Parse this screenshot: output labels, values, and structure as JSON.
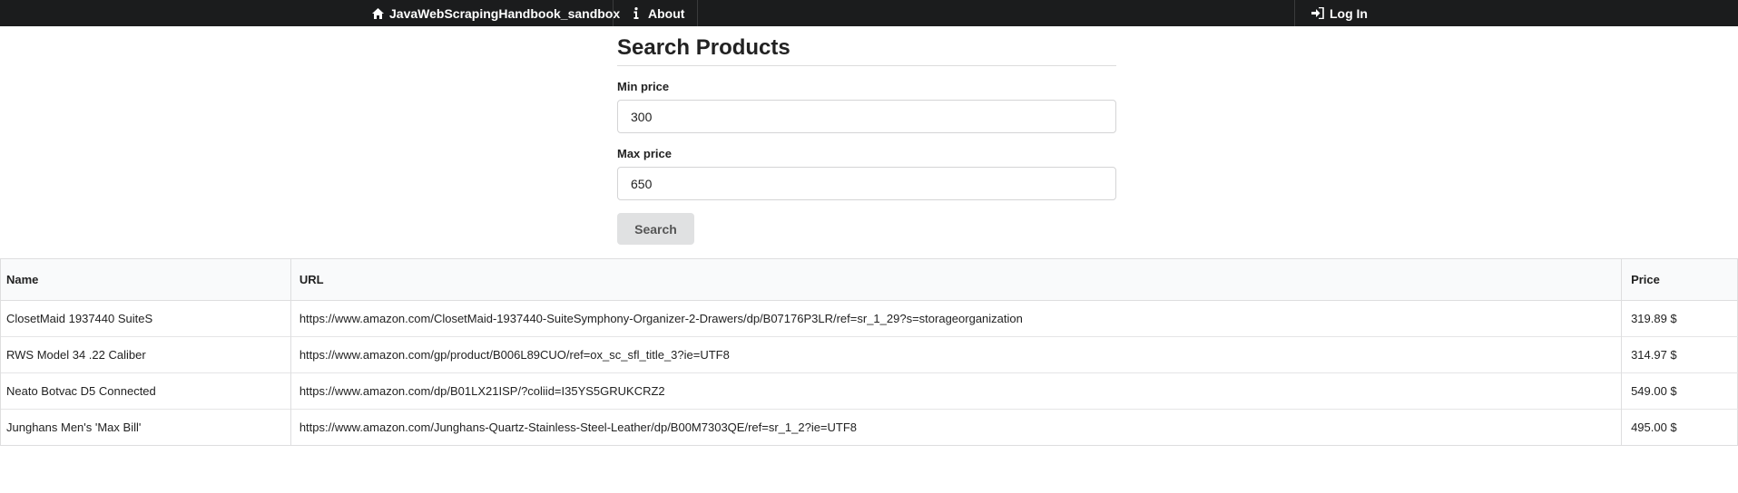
{
  "nav": {
    "brand_label": "JavaWebScrapingHandbook_sandbox",
    "brand_icon": "home-icon",
    "about_label": "About",
    "about_icon": "info-icon",
    "login_label": "Log In",
    "login_icon": "sign-in-icon"
  },
  "form": {
    "title": "Search Products",
    "min_price_label": "Min price",
    "min_price_value": "300",
    "max_price_label": "Max price",
    "max_price_value": "650",
    "search_label": "Search"
  },
  "table": {
    "headers": [
      "Name",
      "URL",
      "Price"
    ],
    "rows": [
      {
        "name": "ClosetMaid 1937440 SuiteS",
        "url": "https://www.amazon.com/ClosetMaid-1937440-SuiteSymphony-Organizer-2-Drawers/dp/B07176P3LR/ref=sr_1_29?s=storageorganization",
        "price": "319.89 $"
      },
      {
        "name": "RWS Model 34 .22 Caliber",
        "url": "https://www.amazon.com/gp/product/B006L89CUO/ref=ox_sc_sfl_title_3?ie=UTF8",
        "price": "314.97 $"
      },
      {
        "name": "Neato Botvac D5 Connected",
        "url": "https://www.amazon.com/dp/B01LX21ISP/?coliid=I35YS5GRUKCRZ2",
        "price": "549.00 $"
      },
      {
        "name": "Junghans Men's 'Max Bill'",
        "url": "https://www.amazon.com/Junghans-Quartz-Stainless-Steel-Leather/dp/B00M7303QE/ref=sr_1_2?ie=UTF8",
        "price": "495.00 $"
      }
    ]
  }
}
